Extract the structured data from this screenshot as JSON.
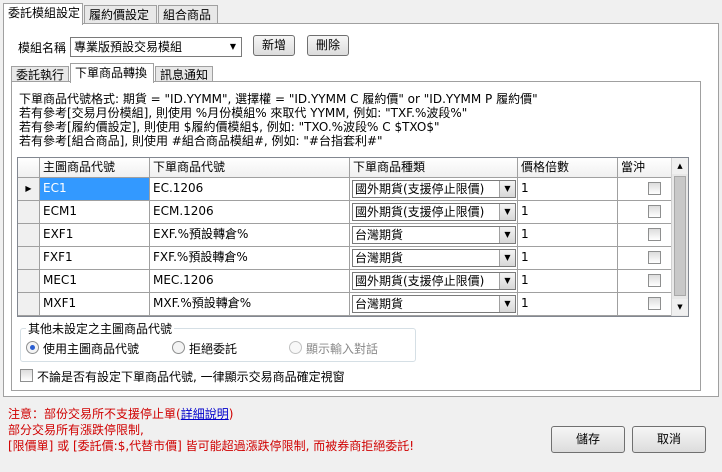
{
  "top_tabs": [
    "委託模組設定",
    "履約價設定",
    "組合商品"
  ],
  "module": {
    "label": "模組名稱",
    "selected": "專業版預設交易模組",
    "add_label": "新增",
    "delete_label": "刪除"
  },
  "sub_tabs": [
    "委託執行",
    "下單商品轉換",
    "訊息通知"
  ],
  "info_lines": [
    "下單商品代號格式: 期貨 = \"ID.YYMM\", 選擇權 = \"ID.YYMM C 履約價\" or \"ID.YYMM P 履約價\"",
    "若有參考[交易月份模組], 則使用 %月份模組% 來取代 YYMM, 例如: \"TXF.%波段%\"",
    "若有參考[履約價設定], 則使用 $履約價模組$, 例如: \"TXO.%波段% C $TXO$\"",
    "若有參考[組合商品], 則使用 #組合商品模組#, 例如: \"#台指套利#\""
  ],
  "grid": {
    "headers": [
      "主圖商品代號",
      "下單商品代號",
      "下單商品種類",
      "價格倍數",
      "當沖"
    ],
    "rows": [
      {
        "main": "EC1",
        "order": "EC.1206",
        "type": "國外期貨(支援停止限價)",
        "mult": "1",
        "selected": true
      },
      {
        "main": "ECM1",
        "order": "ECM.1206",
        "type": "國外期貨(支援停止限價)",
        "mult": "1",
        "selected": false
      },
      {
        "main": "EXF1",
        "order": "EXF.%預設轉倉%",
        "type": "台灣期貨",
        "mult": "1",
        "selected": false
      },
      {
        "main": "FXF1",
        "order": "FXF.%預設轉倉%",
        "type": "台灣期貨",
        "mult": "1",
        "selected": false
      },
      {
        "main": "MEC1",
        "order": "MEC.1206",
        "type": "國外期貨(支援停止限價)",
        "mult": "1",
        "selected": false
      },
      {
        "main": "MXF1",
        "order": "MXF.%預設轉倉%",
        "type": "台灣期貨",
        "mult": "1",
        "selected": false
      }
    ]
  },
  "fallback": {
    "title": "其他未設定之主圖商品代號",
    "options": [
      "使用主圖商品代號",
      "拒絕委託",
      "顯示輸入對話"
    ],
    "selected_index": 0
  },
  "always_show_label": "不論是否有設定下單商品代號, 一律顯示交易商品確定視窗",
  "notice": {
    "line1_prefix": "注意：部份交易所不支援停止單(",
    "line1_link": "詳細說明",
    "line1_suffix": ")",
    "line2": "部分交易所有漲跌停限制,",
    "line3": "[限價單] 或 [委託價:$,代替市價] 皆可能超過漲跌停限制, 而被券商拒絕委託!"
  },
  "buttons": {
    "save": "儲存",
    "cancel": "取消"
  }
}
